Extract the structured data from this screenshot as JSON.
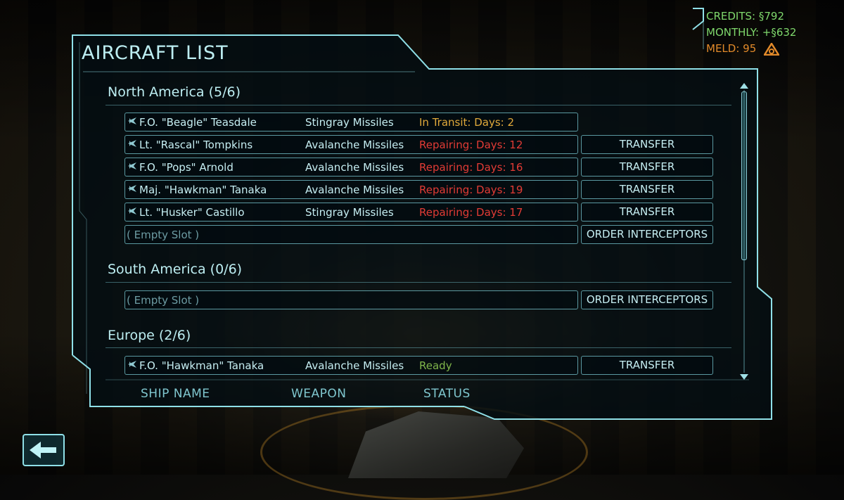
{
  "panel": {
    "title": "AIRCRAFT LIST"
  },
  "resources": {
    "credits": "CREDITS: §792",
    "monthly": "MONTHLY: +§632",
    "meld": "MELD: 95"
  },
  "regions": [
    {
      "header": "North America (5/6)",
      "rows": [
        {
          "name": "F.O. \"Beagle\" Teasdale",
          "weapon": "Stingray Missiles",
          "status": "In Transit: Days: 2",
          "status_type": "transit",
          "action": ""
        },
        {
          "name": "Lt. \"Rascal\" Tompkins",
          "weapon": "Avalanche Missiles",
          "status": "Repairing: Days: 12",
          "status_type": "repair",
          "action": "TRANSFER"
        },
        {
          "name": "F.O. \"Pops\" Arnold",
          "weapon": "Avalanche Missiles",
          "status": "Repairing: Days: 16",
          "status_type": "repair",
          "action": "TRANSFER"
        },
        {
          "name": "Maj. \"Hawkman\" Tanaka",
          "weapon": "Avalanche Missiles",
          "status": "Repairing: Days: 19",
          "status_type": "repair",
          "action": "TRANSFER"
        },
        {
          "name": "Lt. \"Husker\" Castillo",
          "weapon": "Stingray Missiles",
          "status": "Repairing: Days: 17",
          "status_type": "repair",
          "action": "TRANSFER"
        }
      ],
      "empty_slot": "( Empty Slot )",
      "empty_action": "ORDER INTERCEPTORS"
    },
    {
      "header": "South America (0/6)",
      "rows": [],
      "empty_slot": "( Empty Slot )",
      "empty_action": "ORDER INTERCEPTORS"
    },
    {
      "header": "Europe (2/6)",
      "rows": [
        {
          "name": "F.O. \"Hawkman\" Tanaka",
          "weapon": "Avalanche Missiles",
          "status": "Ready",
          "status_type": "ready",
          "action": "TRANSFER"
        }
      ]
    }
  ],
  "columns": {
    "ship_name": "SHIP NAME",
    "weapon": "WEAPON",
    "status": "STATUS"
  },
  "icons": {
    "aircraft": "jet-icon",
    "back": "back-arrow-icon",
    "meld": "meld-icon"
  },
  "colors": {
    "accent": "#8fe0e8",
    "transit": "#e0a93b",
    "repair": "#e23b35",
    "ready": "#7fb54a",
    "credits": "#7fd86c",
    "meld": "#e28a2a"
  }
}
